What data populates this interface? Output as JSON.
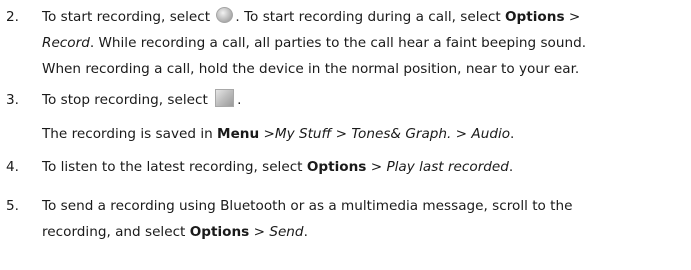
{
  "steps": [
    {
      "number": "2.",
      "lines": [
        {
          "t1": "To start recording, select ",
          "t2": ". To start recording during a call, select ",
          "options": "Options",
          "gt": " >"
        },
        {
          "record": "Record",
          "t3": ". While recording a call, all parties to the call hear a faint beeping sound."
        },
        {
          "t4": "When recording a call, hold the device in the normal position, near to your ear."
        }
      ],
      "icon": "record-circle-icon"
    },
    {
      "number": "3.",
      "text": "To stop recording, select ",
      "end": ".",
      "icon": "stop-square-icon",
      "note": {
        "prefix": "The recording is saved in ",
        "menu": "Menu",
        "sep1": " >",
        "my_stuff": "My Stuff",
        "sep2": " > ",
        "tones": "Tones& Graph.",
        "sep3": " > ",
        "audio": "Audio",
        "end": "."
      }
    },
    {
      "number": "4.",
      "text": "To listen to the latest recording, select ",
      "options": "Options",
      "sep": " > ",
      "item": "Play last recorded",
      "end": "."
    },
    {
      "number": "5.",
      "line1": "To send a recording using Bluetooth or as a multimedia message, scroll to the",
      "line2_prefix": "recording, and select ",
      "options": "Options",
      "sep": " > ",
      "item": "Send",
      "end": "."
    }
  ]
}
